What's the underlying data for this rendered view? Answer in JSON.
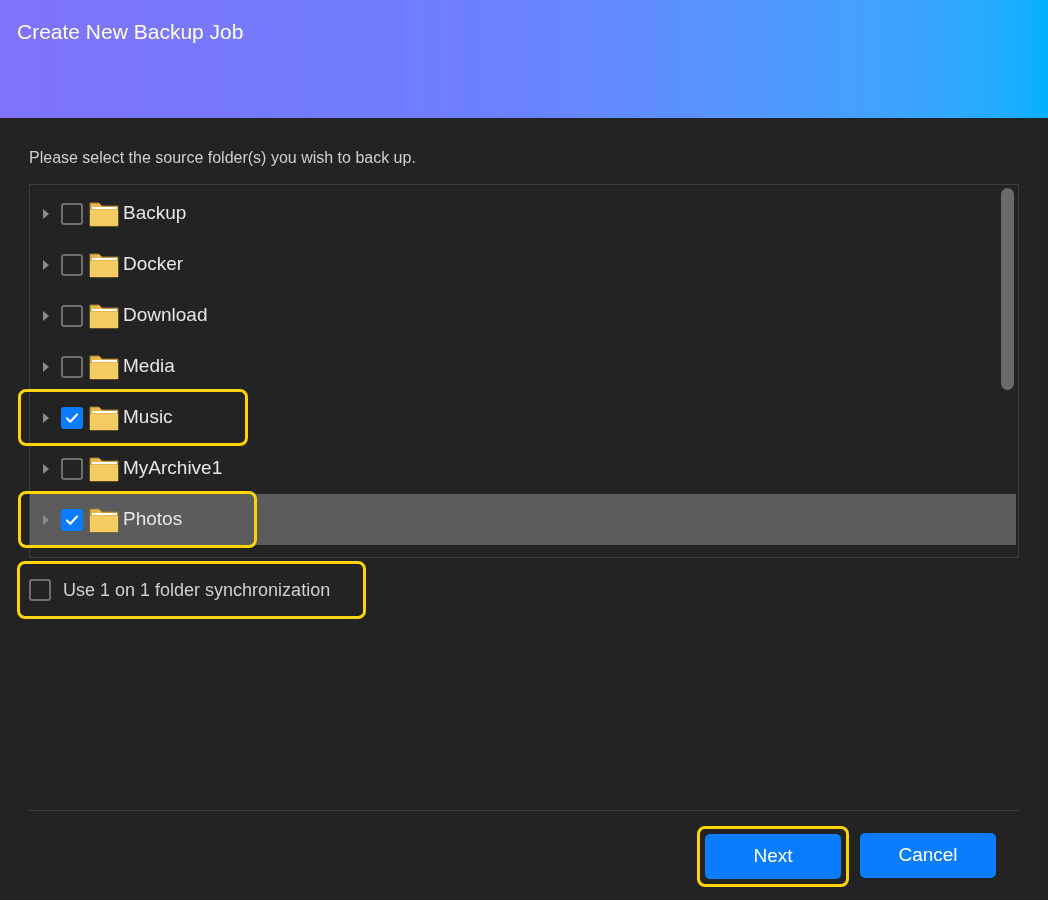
{
  "dialog": {
    "title": "Create New Backup Job"
  },
  "instruction": "Please select the source folder(s) you wish to back up.",
  "folders": [
    {
      "name": "Backup",
      "checked": false,
      "selected": false,
      "highlighted": false
    },
    {
      "name": "Docker",
      "checked": false,
      "selected": false,
      "highlighted": false
    },
    {
      "name": "Download",
      "checked": false,
      "selected": false,
      "highlighted": false
    },
    {
      "name": "Media",
      "checked": false,
      "selected": false,
      "highlighted": false
    },
    {
      "name": "Music",
      "checked": true,
      "selected": false,
      "highlighted": true
    },
    {
      "name": "MyArchive1",
      "checked": false,
      "selected": false,
      "highlighted": false
    },
    {
      "name": "Photos",
      "checked": true,
      "selected": true,
      "highlighted": true
    }
  ],
  "sync_option": {
    "label": "Use 1 on 1 folder synchronization",
    "checked": false,
    "highlighted": true
  },
  "buttons": [
    {
      "label": "Next",
      "highlighted": true
    },
    {
      "label": "Cancel",
      "highlighted": false
    }
  ]
}
